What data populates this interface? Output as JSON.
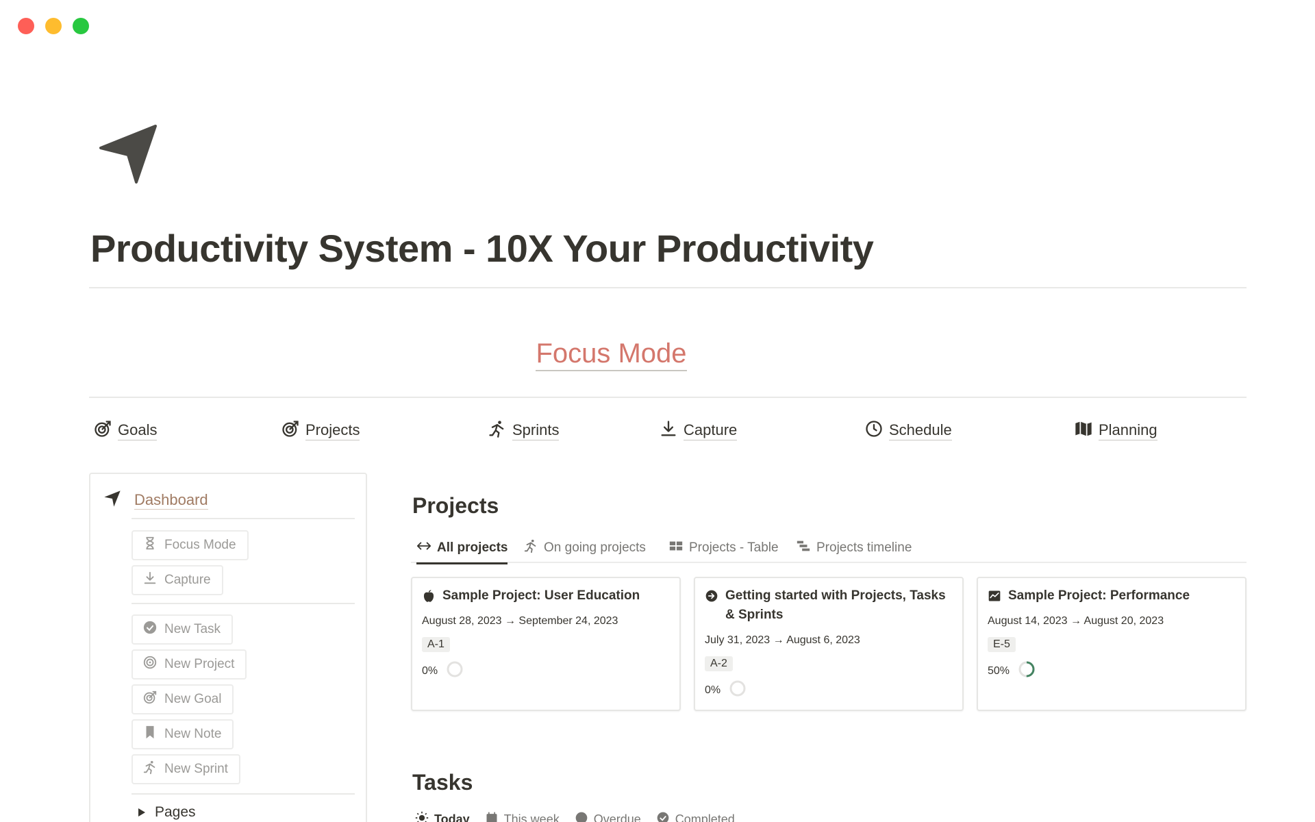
{
  "window": {
    "controls": [
      "close",
      "minimize",
      "maximize"
    ]
  },
  "page": {
    "icon": "navigation-arrow-icon",
    "title": "Productivity System - 10X Your Productivity"
  },
  "focus_mode_link": "Focus Mode",
  "nav_links": [
    {
      "label": "Goals",
      "icon": "target-arrow-icon"
    },
    {
      "label": "Projects",
      "icon": "target-arrow-icon"
    },
    {
      "label": "Sprints",
      "icon": "runner-icon"
    },
    {
      "label": "Capture",
      "icon": "download-icon"
    },
    {
      "label": "Schedule",
      "icon": "clock-icon"
    },
    {
      "label": "Planning",
      "icon": "map-icon"
    }
  ],
  "sidebar": {
    "header": "Dashboard",
    "quick_buttons": [
      {
        "label": "Focus Mode",
        "icon": "hourglass-icon"
      },
      {
        "label": "Capture",
        "icon": "download-icon"
      }
    ],
    "new_buttons": [
      {
        "label": "New Task",
        "icon": "check-circle-icon"
      },
      {
        "label": "New Project",
        "icon": "target-icon"
      },
      {
        "label": "New Goal",
        "icon": "target-arrow-icon"
      },
      {
        "label": "New Note",
        "icon": "bookmark-icon"
      },
      {
        "label": "New Sprint",
        "icon": "runner-icon"
      }
    ],
    "pages_toggle": "Pages"
  },
  "projects": {
    "title": "Projects",
    "tabs": [
      {
        "label": "All projects",
        "icon": "arrows-horizontal-icon",
        "active": true
      },
      {
        "label": "On going projects",
        "icon": "runner-icon",
        "active": false
      },
      {
        "label": "Projects - Table",
        "icon": "table-icon",
        "active": false
      },
      {
        "label": "Projects timeline",
        "icon": "timeline-icon",
        "active": false
      }
    ],
    "cards": [
      {
        "title": "Sample Project: User Education",
        "icon": "apple-icon",
        "dates": "August 28, 2023 → September 24, 2023",
        "tag": "A-1",
        "progress_label": "0%",
        "progress": 0
      },
      {
        "title": "Getting started with Projects, Tasks & Sprints",
        "icon": "arrow-circle-right-icon",
        "dates": "July 31, 2023 → August 6, 2023",
        "tag": "A-2",
        "progress_label": "0%",
        "progress": 0
      },
      {
        "title": "Sample Project: Performance",
        "icon": "chart-line-icon",
        "dates": "August 14, 2023 → August 20, 2023",
        "tag": "E-5",
        "progress_label": "50%",
        "progress": 0.5
      }
    ]
  },
  "tasks": {
    "title": "Tasks",
    "tabs": [
      {
        "label": "Today",
        "icon": "sun-icon",
        "active": true
      },
      {
        "label": "This week",
        "icon": "calendar-icon",
        "active": false
      },
      {
        "label": "Overdue",
        "icon": "clock-icon",
        "active": false
      },
      {
        "label": "Completed",
        "icon": "check-circle-icon",
        "active": false
      }
    ]
  },
  "colors": {
    "text": "#37352f",
    "muted": "#9b9a97",
    "focus_link": "#d4776c",
    "dashboard_link": "#a07b63",
    "progress_fill": "#448361",
    "progress_empty": "#e3e2e0"
  }
}
